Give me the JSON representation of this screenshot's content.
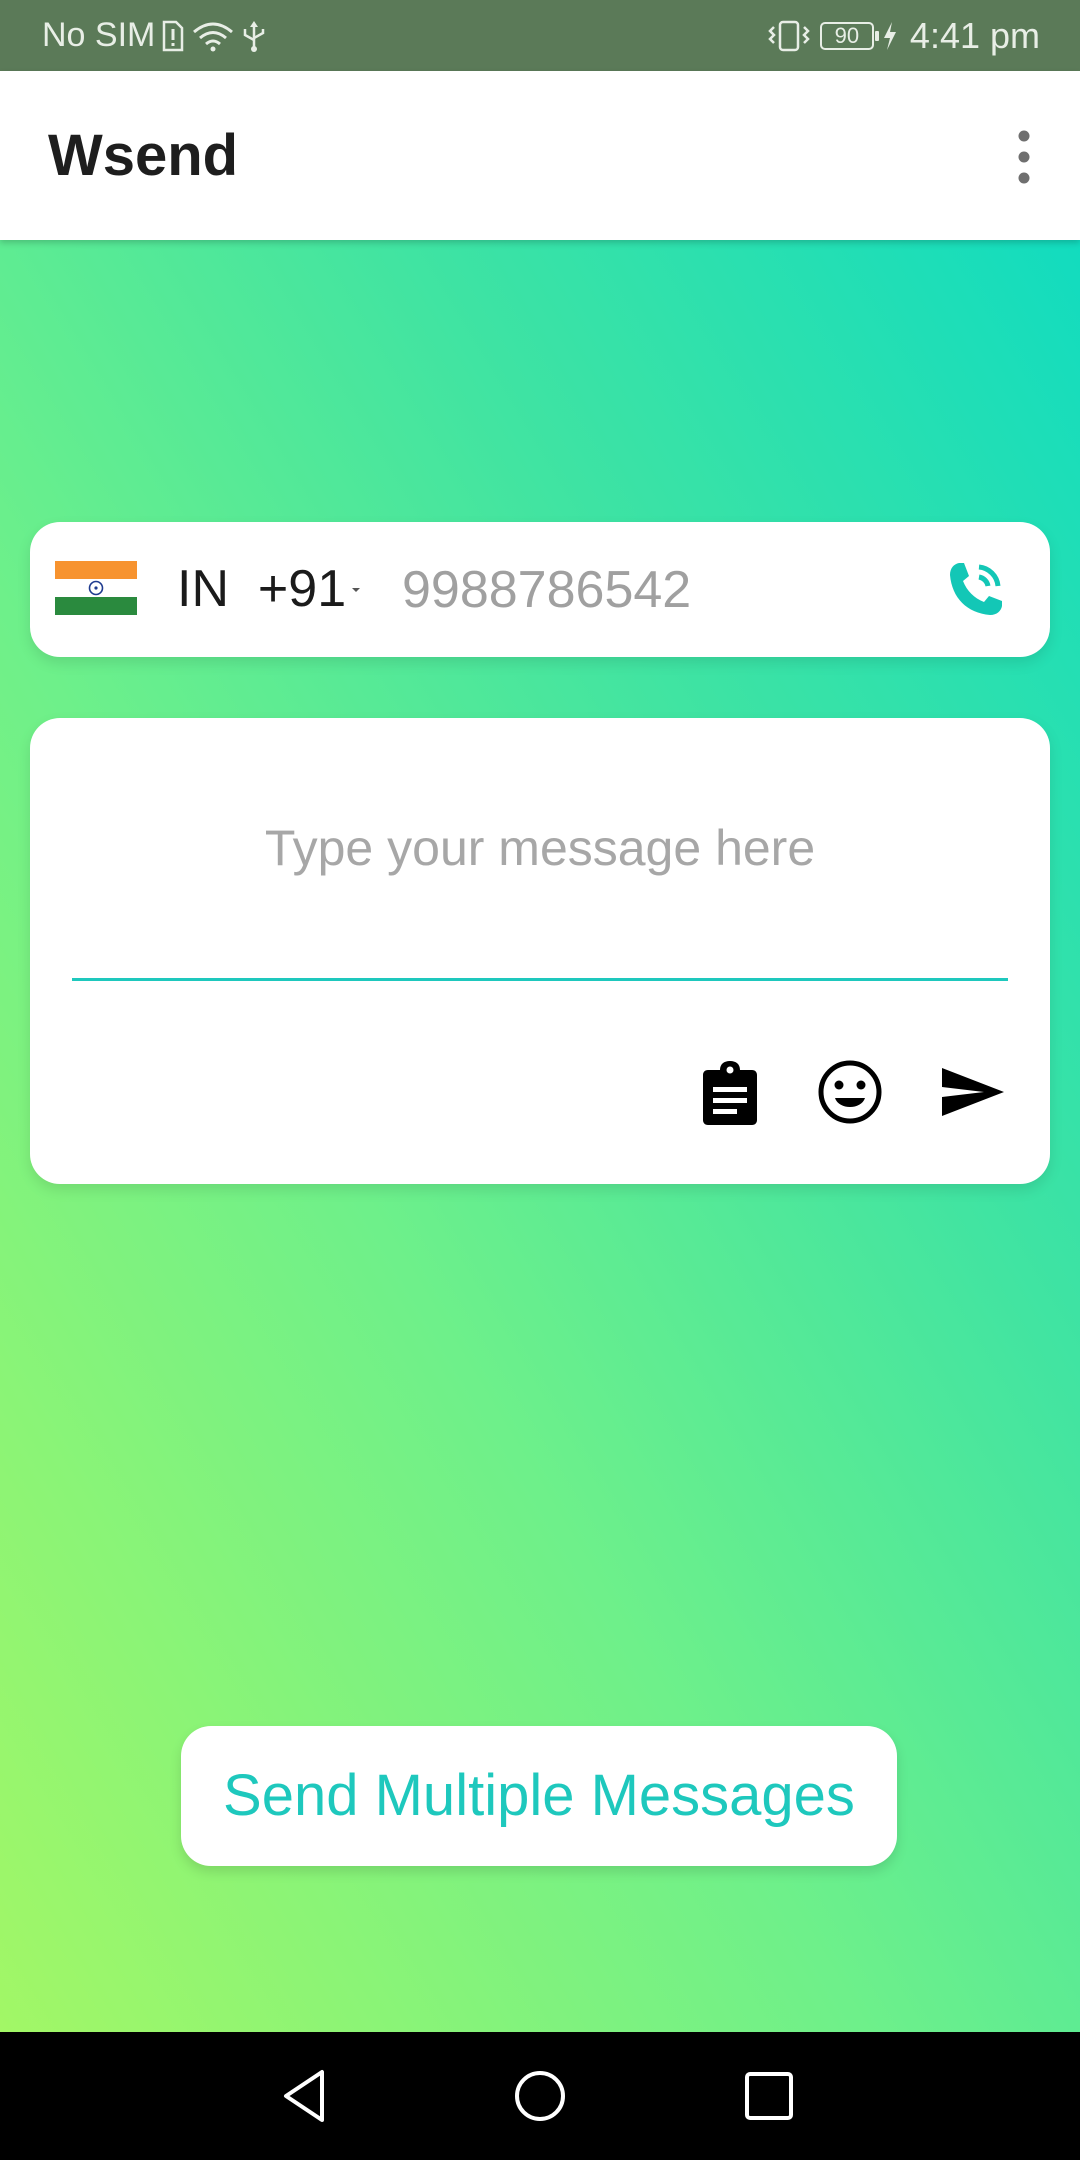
{
  "status_bar": {
    "carrier": "No SIM",
    "battery": "90",
    "time": "4:41 pm"
  },
  "app_bar": {
    "title": "Wsend",
    "overflow_icon": "more-vert-icon"
  },
  "phone_field": {
    "country": "IN",
    "dial_code": "+91",
    "placeholder": "9988786542",
    "flag_icon": "india-flag-icon",
    "action_icon": "phone-call-icon"
  },
  "message_field": {
    "placeholder": "Type your message here",
    "actions": [
      "clipboard-icon",
      "emoji-icon",
      "send-icon"
    ]
  },
  "multi_button": {
    "label": "Send Multiple Messages"
  },
  "colors": {
    "status_bar": "#5b7a58",
    "accent": "#1ec8bd",
    "gradient_top": "#12dcbf",
    "gradient_bottom": "#a2f766"
  },
  "nav_bar": {
    "icons": [
      "back-icon",
      "home-icon",
      "recents-icon"
    ]
  }
}
